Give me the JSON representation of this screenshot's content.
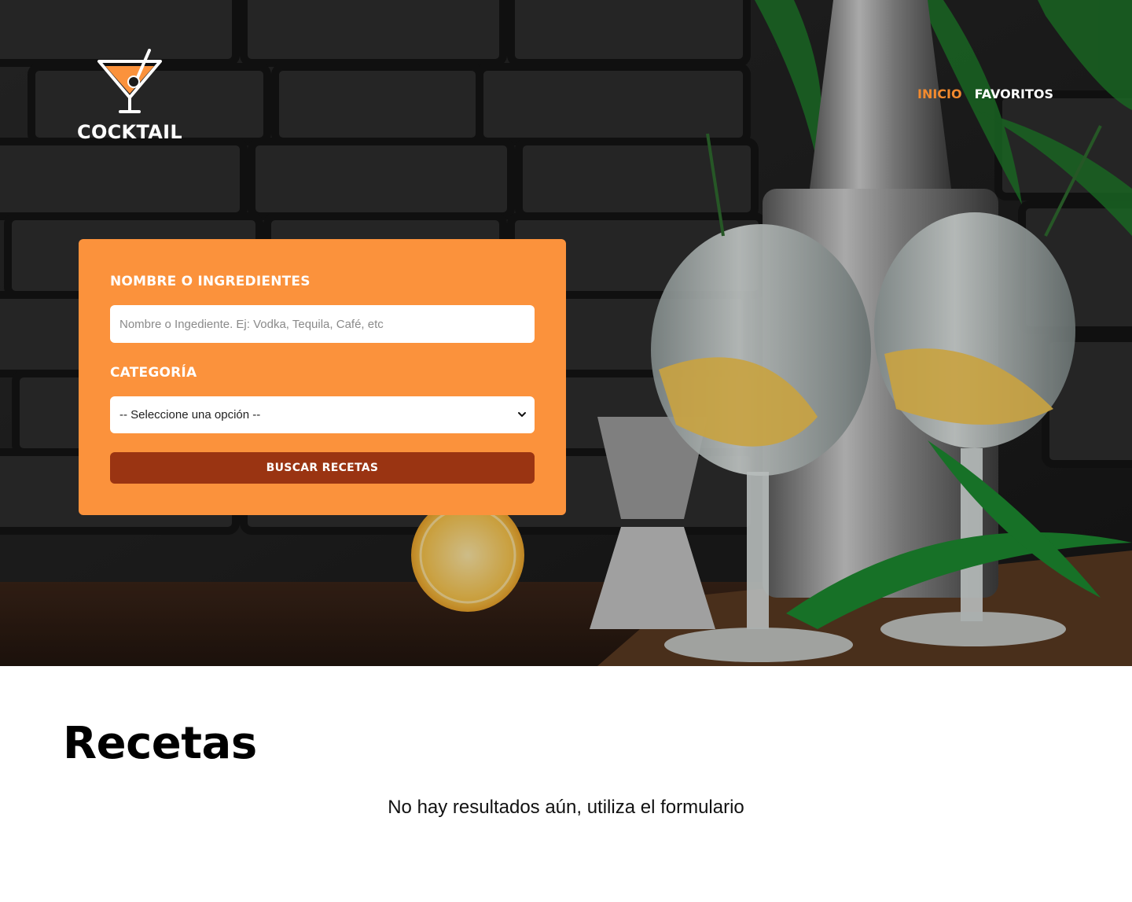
{
  "brand": {
    "name": "COCKTAIL",
    "logo_icon": "cocktail-glass-icon",
    "accent_color": "#fb923c",
    "button_color": "#9a3412"
  },
  "nav": {
    "items": [
      {
        "label": "INICIO",
        "active": true
      },
      {
        "label": "FAVORITOS",
        "active": false
      }
    ]
  },
  "hero": {
    "background": "photo-two-gin-tonic-cocktails-with-lemon-and-rosemary"
  },
  "search_form": {
    "name_label": "NOMBRE O INGREDIENTES",
    "name_placeholder": "Nombre o Ingediente. Ej: Vodka, Tequila, Café, etc",
    "name_value": "",
    "category_label": "CATEGORÍA",
    "category_selected": "-- Seleccione una opción --",
    "submit_label": "BUSCAR RECETAS"
  },
  "results": {
    "title": "Recetas",
    "empty_message": "No hay resultados aún, utiliza el formulario"
  }
}
